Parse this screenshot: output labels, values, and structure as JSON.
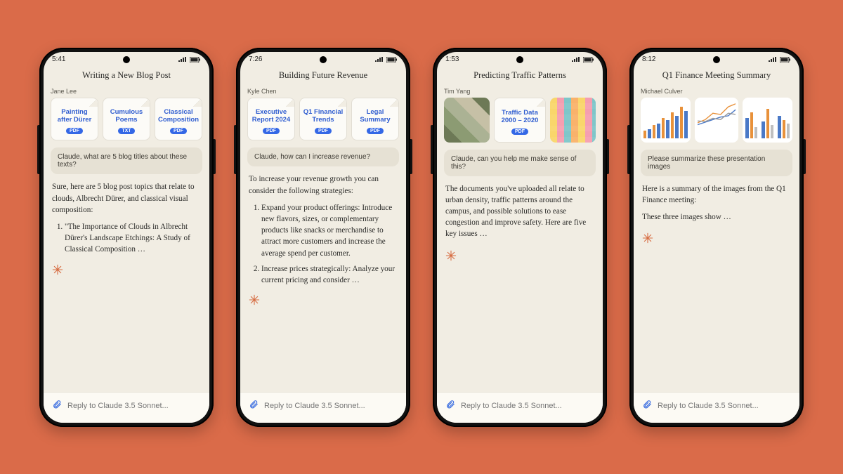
{
  "composer_placeholder": "Reply to Claude 3.5 Sonnet...",
  "file_badges": {
    "pdf": "PDF",
    "txt": "TXT"
  },
  "phones": [
    {
      "time": "5:41",
      "title": "Writing a New Blog Post",
      "author": "Jane Lee",
      "files": [
        {
          "name": "Painting after Dürer",
          "type": "pdf"
        },
        {
          "name": "Cumulous Poems",
          "type": "txt"
        },
        {
          "name": "Classical Composition",
          "type": "pdf"
        }
      ],
      "user_prompt": "Claude, what are 5 blog titles about these texts?",
      "assistant_intro": "Sure, here are 5 blog post topics that relate to clouds, Albrecht Dürer, and classical visual composition:",
      "assistant_items": [
        "\"The Importance of Clouds in Albrecht Dürer's Landscape Etchings: A Study of Classical Composition …"
      ]
    },
    {
      "time": "7:26",
      "title": "Building Future Revenue",
      "author": "Kyle Chen",
      "files": [
        {
          "name": "Executive Report 2024",
          "type": "pdf"
        },
        {
          "name": "Q1 Financial Trends",
          "type": "pdf"
        },
        {
          "name": "Legal Summary",
          "type": "pdf"
        }
      ],
      "user_prompt": "Claude, how can I increase revenue?",
      "assistant_intro": "To increase your revenue growth you can consider the following strategies:",
      "assistant_items": [
        "Expand your product offerings: Introduce new flavors, sizes, or complementary products like snacks or merchandise to attract more customers and increase the average spend per customer.",
        "Increase prices strategically: Analyze your current pricing and consider …"
      ]
    },
    {
      "time": "1:53",
      "title": "Predicting Traffic Patterns",
      "author": "Tim Yang",
      "mixed_attachments": {
        "left_image": "aerial-campus-photo",
        "file": {
          "name": "Traffic Data 2000 – 2020",
          "type": "pdf"
        },
        "right_image": "sticky-notes-photo"
      },
      "user_prompt": "Claude, can you help me make sense of this?",
      "assistant_intro": "The documents you've uploaded all relate to urban density, traffic patterns around the campus, and possible solutions to ease congestion and improve safety. Here are five key issues …"
    },
    {
      "time": "8:12",
      "title": "Q1 Finance Meeting Summary",
      "author": "Michael Culver",
      "chart_images": [
        "stacked-bar-chart",
        "multi-line-chart",
        "grouped-bar-chart"
      ],
      "user_prompt": "Please summarize these presentation images",
      "assistant_intro": "Here is a summary of the images from the Q1 Finance meeting:",
      "assistant_line2": "These three images show …"
    }
  ]
}
